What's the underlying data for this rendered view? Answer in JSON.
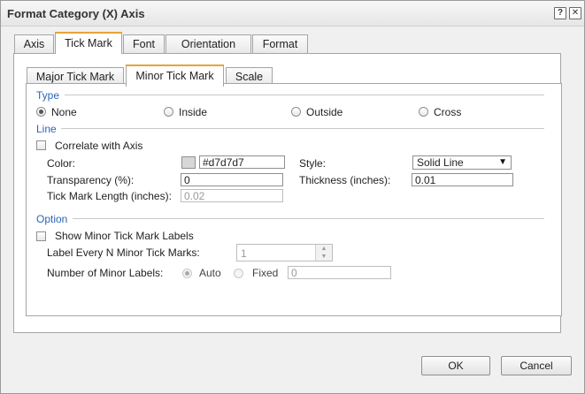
{
  "window": {
    "title": "Format Category (X) Axis",
    "help_glyph": "?",
    "close_glyph": "✕"
  },
  "outer_tabs": [
    {
      "label": "Axis"
    },
    {
      "label": "Tick Mark",
      "active": true
    },
    {
      "label": "Font"
    },
    {
      "label": "Orientation"
    },
    {
      "label": "Format"
    }
  ],
  "inner_tabs": [
    {
      "label": "Major Tick Mark"
    },
    {
      "label": "Minor Tick Mark",
      "active": true
    },
    {
      "label": "Scale"
    }
  ],
  "type_section": {
    "label": "Type",
    "options": [
      {
        "label": "None",
        "checked": true
      },
      {
        "label": "Inside",
        "checked": false
      },
      {
        "label": "Outside",
        "checked": false
      },
      {
        "label": "Cross",
        "checked": false
      }
    ]
  },
  "line_section": {
    "label": "Line",
    "correlate_label": "Correlate with Axis",
    "color_label": "Color:",
    "color_value": "#d7d7d7",
    "swatch_color": "#d7d7d7",
    "style_label": "Style:",
    "style_value": "Solid Line",
    "transparency_label": "Transparency (%):",
    "transparency_value": "0",
    "thickness_label": "Thickness (inches):",
    "thickness_value": "0.01",
    "tick_length_label": "Tick Mark Length (inches):",
    "tick_length_value": "0.02"
  },
  "option_section": {
    "label": "Option",
    "show_labels_label": "Show Minor Tick Mark Labels",
    "label_every_label": "Label Every N Minor Tick Marks:",
    "label_every_value": "1",
    "number_labels_label": "Number of Minor Labels:",
    "auto_label": "Auto",
    "fixed_label": "Fixed",
    "fixed_value": "0"
  },
  "footer": {
    "ok_label": "OK",
    "cancel_label": "Cancel"
  },
  "colors": {
    "section_label": "#2a66b8",
    "active_tab_accent": "#e8a33c"
  }
}
